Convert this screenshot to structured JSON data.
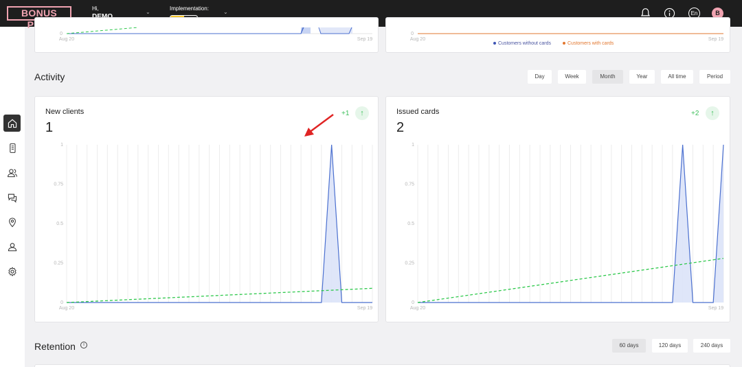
{
  "header": {
    "logo": "BONUS PINK",
    "greeting": "Hi,",
    "user": "DEMO",
    "implementation_label": "Implementation:",
    "implementation_progress": 0.5,
    "language": "En",
    "avatar_letter": "B",
    "icons": [
      "bell-icon",
      "info-icon",
      "language-icon",
      "avatar"
    ]
  },
  "sidebar": {
    "items": [
      {
        "name": "home",
        "icon": "home-icon",
        "active": true
      },
      {
        "name": "cards",
        "icon": "phone-card-icon",
        "active": false
      },
      {
        "name": "customers",
        "icon": "users-icon",
        "active": false
      },
      {
        "name": "messages",
        "icon": "chat-icon",
        "active": false
      },
      {
        "name": "locations",
        "icon": "location-pin-icon",
        "active": false
      },
      {
        "name": "staff",
        "icon": "user-icon",
        "active": false
      },
      {
        "name": "settings",
        "icon": "gear-icon",
        "active": false
      }
    ]
  },
  "top_cards": {
    "left": {
      "x_start": "Aug 20",
      "x_end": "Sep 19",
      "y_zero": "0"
    },
    "right": {
      "x_start": "Aug 20",
      "x_end": "Sep 19",
      "y_zero": "0",
      "legend": [
        "Customers without cards",
        "Customers with cards"
      ],
      "legend_colors": [
        "#3f56b5",
        "#e2772f"
      ]
    }
  },
  "activity": {
    "title": "Activity",
    "periods": [
      "Day",
      "Week",
      "Month",
      "Year",
      "All time",
      "Period"
    ],
    "active_period": "Month"
  },
  "cards": {
    "new_clients": {
      "title": "New clients",
      "value": "1",
      "delta": "+1"
    },
    "issued_cards": {
      "title": "Issued cards",
      "value": "2",
      "delta": "+2"
    }
  },
  "retention": {
    "title": "Retention",
    "info": "i",
    "periods": [
      "60 days",
      "120 days",
      "240 days"
    ],
    "active_period": "60 days"
  },
  "chart_data": [
    {
      "type": "area",
      "x_start": "Aug 20",
      "x_end": "Sep 19",
      "y_ticks": [
        "1",
        "0.75",
        "0.5",
        "0.25",
        "0"
      ],
      "ylim": [
        0,
        1
      ],
      "n_points": 31,
      "series": [
        {
          "values": [
            0,
            0,
            0,
            0,
            0,
            0,
            0,
            0,
            0,
            0,
            0,
            0,
            0,
            0,
            0,
            0,
            0,
            0,
            0,
            0,
            0,
            0,
            0,
            0,
            0,
            0,
            1,
            0,
            0,
            0,
            0
          ],
          "color": "#4a6fcf"
        }
      ],
      "trend": {
        "start": 0,
        "end": 0.09,
        "color": "#2cc84a"
      },
      "grid": true
    },
    {
      "type": "area",
      "x_start": "Aug 20",
      "x_end": "Sep 19",
      "y_ticks": [
        "1",
        "0.75",
        "0.5",
        "0.25",
        "0"
      ],
      "ylim": [
        0,
        1
      ],
      "n_points": 31,
      "series": [
        {
          "values": [
            0,
            0,
            0,
            0,
            0,
            0,
            0,
            0,
            0,
            0,
            0,
            0,
            0,
            0,
            0,
            0,
            0,
            0,
            0,
            0,
            0,
            0,
            0,
            0,
            0,
            0,
            1,
            0,
            0,
            0,
            1
          ],
          "color": "#4a6fcf"
        }
      ],
      "trend": {
        "start": 0,
        "end": 0.28,
        "color": "#2cc84a"
      },
      "grid": true
    }
  ]
}
